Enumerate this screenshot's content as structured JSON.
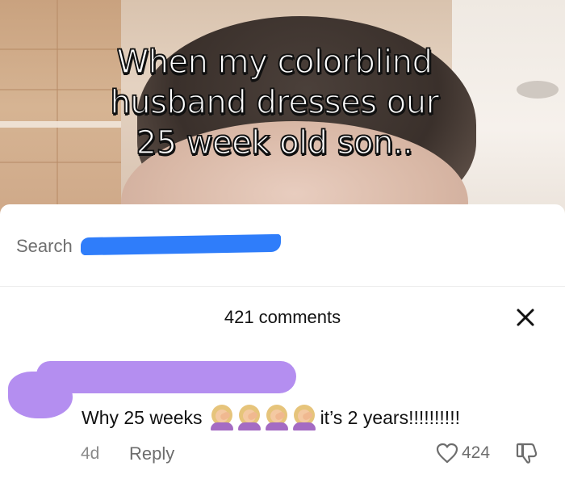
{
  "video": {
    "caption": "When my colorblind\nhusband dresses our\n25 week old son.."
  },
  "search": {
    "placeholder": "Search"
  },
  "comments_panel": {
    "count_label": "421 comments",
    "close_icon": "close-icon"
  },
  "comment": {
    "text_before": "Why 25 weeks",
    "emoji": [
      "woman-facepalming",
      "woman-facepalming",
      "woman-facepalming",
      "woman-facepalming"
    ],
    "text_after": "it’s 2 years!!!!!!!!!!",
    "age": "4d",
    "reply_label": "Reply",
    "like_count": "424"
  },
  "colors": {
    "redaction_blue": "#2f7dfa",
    "redaction_purple": "#b48ef0"
  }
}
